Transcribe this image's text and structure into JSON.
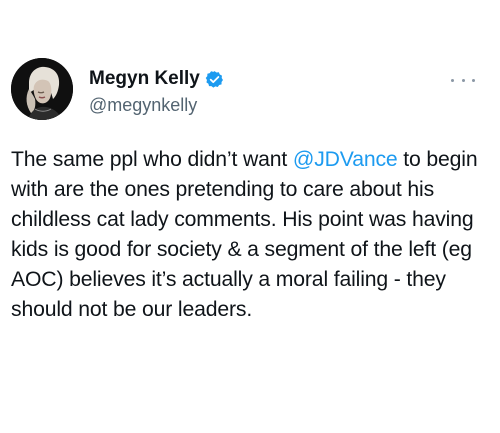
{
  "tweet": {
    "author": {
      "display_name": "Megyn Kelly",
      "handle": "@megynkelly",
      "verified": true,
      "avatar_icon": "profile-photo",
      "verified_icon": "verified-badge-icon",
      "verified_color": "#1d9bf0"
    },
    "more_icon": "more-options-icon",
    "text_before_mention": "The same ppl who didn’t want ",
    "mention": "@JDVance",
    "text_after_mention": " to begin with are the ones pretending to care about his childless cat lady comments. His point was having kids is good for society & a segment of the left (eg AOC) believes it’s actually a moral failing - they should not be our leaders."
  },
  "colors": {
    "text": "#0f1419",
    "secondary_text": "#536471",
    "mention": "#1d9bf0",
    "background": "#ffffff"
  }
}
